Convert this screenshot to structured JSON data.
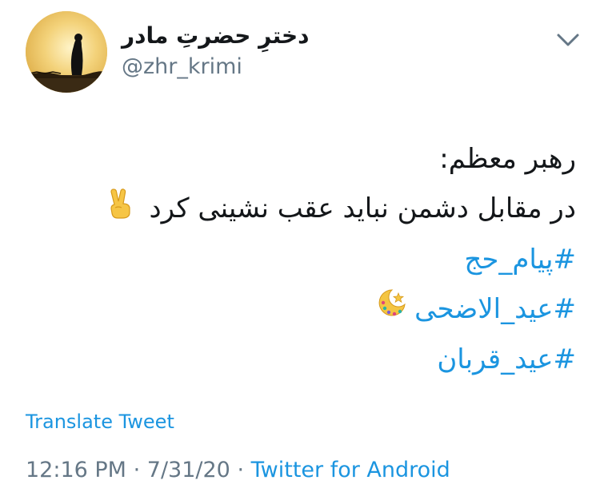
{
  "user": {
    "display_name": "دخترِ حضرتِ مادر",
    "handle": "@zhr_krimi",
    "avatar": "silhouette-at-sunset-avatar",
    "menu_icon": "chevron-down-icon"
  },
  "tweet": {
    "line1": "رهبر معظم:",
    "line2": "در مقابل دشمن نباید عقب نشینی کرد",
    "line2_emoji": "victory-hand-emoji",
    "hashtags": [
      "#پیام_حج",
      "#عید_الاضحی",
      "#عید_قربان"
    ],
    "hashtag2_emoji": "crescent-moon-star-emoji"
  },
  "translate_label": "Translate Tweet",
  "meta": {
    "time": "12:16 PM",
    "separator": "·",
    "date": "7/31/20",
    "source": "Twitter for Android"
  },
  "colors": {
    "link": "#1b95e0",
    "secondary_text": "#657786",
    "primary_text": "#14171a"
  }
}
